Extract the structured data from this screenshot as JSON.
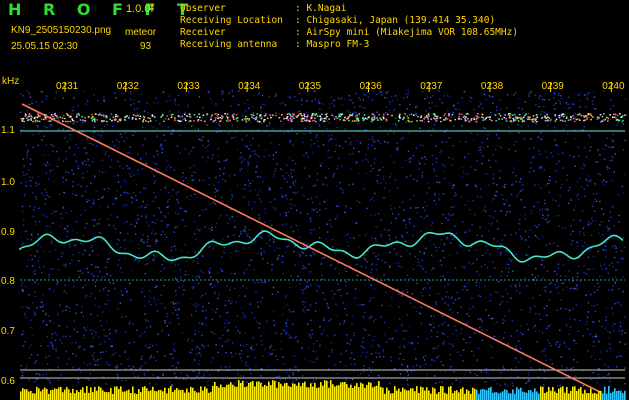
{
  "header": {
    "title": "H R O F F T",
    "version": "1.0.0f",
    "filename": "KN9_2505150230.png",
    "mode": "meteor",
    "datetime": "25.05.15 02:30",
    "count": "93",
    "observer_label": "Observer",
    "observer_value": ": K.Nagai",
    "location_label": "Receiving Location",
    "location_value": ": Chigasaki, Japan (139.414 35.340)",
    "receiver_label": "Receiver",
    "receiver_value": ": AirSpy mini (Miakejima VOR 108.65MHz)",
    "antenna_label": "Receiving antenna",
    "antenna_value": ": Maspro FM-3"
  },
  "axis": {
    "unit": "kHz",
    "time_ticks": [
      "0231",
      "0232",
      "0233",
      "0234",
      "0235",
      "0236",
      "0237",
      "0238",
      "0239",
      "0240"
    ],
    "freq_ticks": [
      "1.1",
      "1.0",
      "0.9",
      "0.8",
      "0.7",
      "0.6"
    ]
  },
  "colors": {
    "background": "#000000",
    "header_text": "#ffd700",
    "title": "#2fdc2f",
    "noise": "#1a2fa8",
    "carrier": "#44e6c8",
    "meteor_trace": "#ff6060",
    "level_bar": "#ffee00"
  }
}
